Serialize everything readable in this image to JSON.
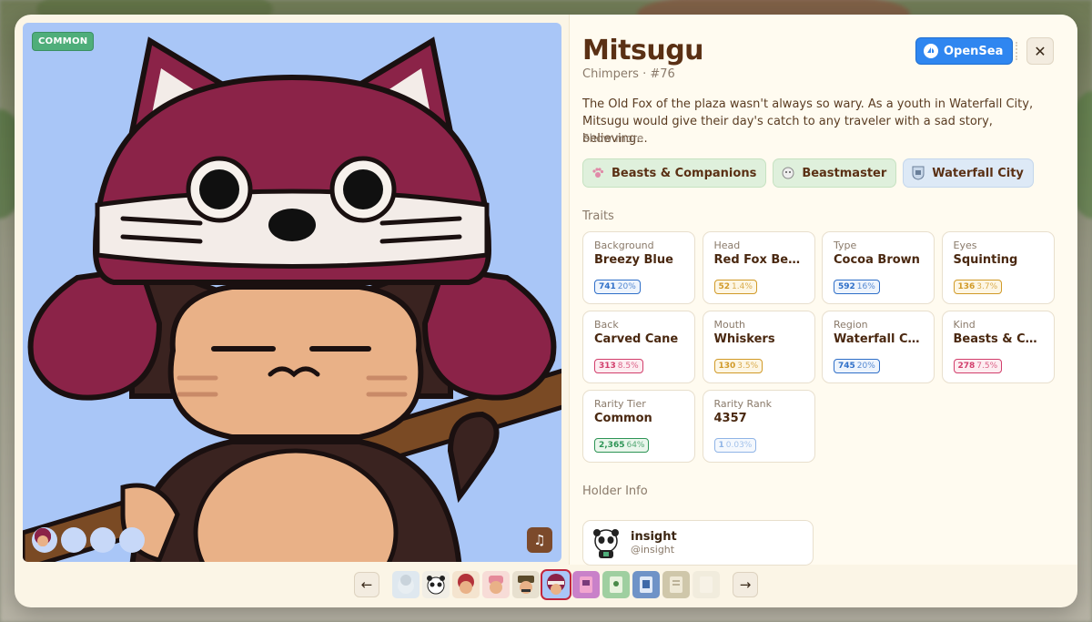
{
  "nft": {
    "name": "Mitsugu",
    "subtitle": "Chimpers · #76",
    "rarity_badge": "COMMON",
    "description": "The Old Fox of the plaza wasn't always so wary. As a youth in Waterfall City, Mitsugu would give their day's catch to any traveler with a sad story, believing...",
    "show_more": "Show more"
  },
  "actions": {
    "opensea_label": "OpenSea",
    "close_icon": "close-icon",
    "music_icon": "music-note-icon"
  },
  "tags": [
    {
      "label": "Beasts & Companions",
      "icon": "paw-icon",
      "style": "green"
    },
    {
      "label": "Beastmaster",
      "icon": "beast-icon",
      "style": "green"
    },
    {
      "label": "Waterfall City",
      "icon": "shield-icon",
      "style": "blue"
    }
  ],
  "traits_label": "Traits",
  "traits": [
    {
      "label": "Background",
      "value": "Breezy Blue",
      "count": "741",
      "pct": "20%",
      "color": "blue"
    },
    {
      "label": "Head",
      "value": "Red Fox Bea...",
      "count": "52",
      "pct": "1.4%",
      "color": "yellow"
    },
    {
      "label": "Type",
      "value": "Cocoa Brown",
      "count": "592",
      "pct": "16%",
      "color": "blue"
    },
    {
      "label": "Eyes",
      "value": "Squinting",
      "count": "136",
      "pct": "3.7%",
      "color": "yellow"
    },
    {
      "label": "Back",
      "value": "Carved Cane",
      "count": "313",
      "pct": "8.5%",
      "color": "pink"
    },
    {
      "label": "Mouth",
      "value": "Whiskers",
      "count": "130",
      "pct": "3.5%",
      "color": "yellow"
    },
    {
      "label": "Region",
      "value": "Waterfall City",
      "count": "745",
      "pct": "20%",
      "color": "blue"
    },
    {
      "label": "Kind",
      "value": "Beasts & Co...",
      "count": "278",
      "pct": "7.5%",
      "color": "pink"
    },
    {
      "label": "Rarity Tier",
      "value": "Common",
      "count": "2,365",
      "pct": "64%",
      "color": "green"
    },
    {
      "label": "Rarity Rank",
      "value": "4357",
      "count": "1",
      "pct": "0.03%",
      "color": "faint"
    }
  ],
  "holder_label": "Holder Info",
  "holder": {
    "name": "insight",
    "handle": "@insight"
  },
  "carousel": {
    "prev_icon": "arrow-left-icon",
    "next_icon": "arrow-right-icon",
    "thumbnails": 11,
    "active_index": 5
  },
  "colors": {
    "accent": "#2f86f0",
    "title": "#5a3014",
    "art_background": "#a9c6f7",
    "badge": "#4fae7a",
    "hat": "#8b2348"
  }
}
